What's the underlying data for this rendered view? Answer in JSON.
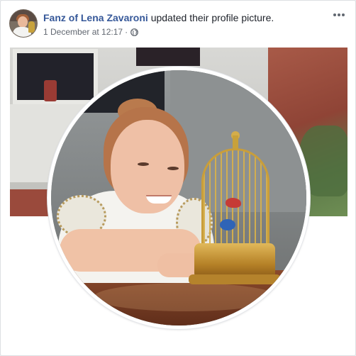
{
  "post": {
    "author": "Fanz of Lena Zavaroni",
    "action": "updated their profile picture.",
    "timestamp": "1 December at 12:17",
    "separator": "·",
    "privacy_icon": "globe-icon",
    "more_icon": "more-options-icon"
  },
  "colors": {
    "author_link": "#365899",
    "meta_text": "#616770",
    "card_border": "#dddfe2"
  }
}
